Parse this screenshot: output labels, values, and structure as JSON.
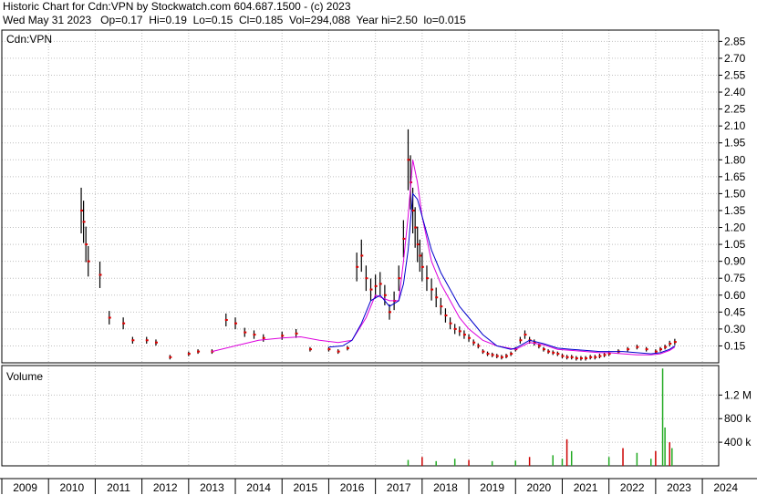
{
  "header": {
    "line1": "Historic Chart for Cdn:VPN by Stockwatch.com 604.687.1500 - (c) 2023",
    "line2": "Wed May 31 2023   Op=0.17  Hi=0.19  Lo=0.15  Cl=0.185  Vol=294,088  Year hi=2.50  lo=0.015"
  },
  "price_panel": {
    "label": "Cdn:VPN"
  },
  "volume_panel": {
    "label": "Volume"
  },
  "colors": {
    "price_bars": "#000000",
    "close_marks": "#dd0000",
    "ma_short": "#0000cc",
    "ma_long": "#dd00dd",
    "volume_up": "#22aa22",
    "volume_down": "#cc0000",
    "grid": "#c0c0c0"
  },
  "chart_data": {
    "type": "line",
    "title": "Historic Chart for Cdn:VPN",
    "ylabel": "",
    "xlabel": "",
    "grid": true,
    "price_axis": {
      "ticks": [
        0.15,
        0.3,
        0.45,
        0.6,
        0.75,
        0.9,
        1.05,
        1.2,
        1.35,
        1.5,
        1.65,
        1.8,
        1.95,
        2.1,
        2.25,
        2.4,
        2.55,
        2.7,
        2.85
      ],
      "tick_labels": [
        "0.15",
        "0.30",
        "0.45",
        "0.60",
        "0.75",
        "0.90",
        "1.05",
        "1.20",
        "1.35",
        "1.50",
        "1.65",
        "1.80",
        "1.95",
        "2.10",
        "2.25",
        "2.40",
        "2.55",
        "2.70",
        "2.85"
      ],
      "ylim": [
        0,
        2.95
      ],
      "position": "right"
    },
    "volume_axis": {
      "ticks": [
        400000,
        800000,
        1200000
      ],
      "tick_labels": [
        "400 k",
        "800 k",
        "1.2 M"
      ],
      "ylim": [
        0,
        1700000
      ],
      "position": "right"
    },
    "x_axis": {
      "years": [
        "2009",
        "2010",
        "2011",
        "2012",
        "2013",
        "2014",
        "2015",
        "2016",
        "2017",
        "2018",
        "2019",
        "2020",
        "2021",
        "2022",
        "2023",
        "2024"
      ],
      "xlim": [
        2009.0,
        2024.35
      ]
    },
    "series": [
      {
        "role": "close",
        "x": [
          2010.7,
          2010.75,
          2010.8,
          2010.85,
          2011.1,
          2011.3,
          2011.6,
          2011.8,
          2012.1,
          2012.3,
          2012.6,
          2013.0,
          2013.2,
          2013.5,
          2013.8,
          2014.0,
          2014.2,
          2014.4,
          2014.6,
          2015.0,
          2015.3,
          2015.6,
          2016.0,
          2016.2,
          2016.4,
          2016.6,
          2016.7,
          2016.8,
          2016.9,
          2017.0,
          2017.1,
          2017.2,
          2017.3,
          2017.4,
          2017.5,
          2017.6,
          2017.7,
          2017.75,
          2017.8,
          2017.85,
          2017.9,
          2017.95,
          2018.0,
          2018.1,
          2018.2,
          2018.3,
          2018.4,
          2018.5,
          2018.6,
          2018.7,
          2018.8,
          2018.9,
          2019.0,
          2019.1,
          2019.2,
          2019.3,
          2019.4,
          2019.5,
          2019.6,
          2019.7,
          2019.8,
          2019.9,
          2020.0,
          2020.1,
          2020.2,
          2020.3,
          2020.4,
          2020.5,
          2020.6,
          2020.7,
          2020.8,
          2020.9,
          2021.0,
          2021.1,
          2021.2,
          2021.3,
          2021.4,
          2021.5,
          2021.6,
          2021.7,
          2021.8,
          2021.9,
          2022.0,
          2022.2,
          2022.4,
          2022.6,
          2022.8,
          2023.0,
          2023.1,
          2023.2,
          2023.3,
          2023.41
        ],
        "values": [
          1.35,
          1.25,
          1.05,
          0.9,
          0.78,
          0.4,
          0.35,
          0.2,
          0.2,
          0.18,
          0.05,
          0.08,
          0.1,
          0.1,
          0.38,
          0.35,
          0.27,
          0.25,
          0.22,
          0.24,
          0.26,
          0.12,
          0.12,
          0.1,
          0.13,
          0.85,
          0.95,
          0.75,
          0.65,
          0.68,
          0.7,
          0.6,
          0.45,
          0.55,
          0.75,
          1.1,
          1.8,
          1.6,
          1.35,
          1.2,
          1.05,
          0.95,
          0.85,
          0.75,
          0.65,
          0.58,
          0.5,
          0.42,
          0.35,
          0.3,
          0.28,
          0.25,
          0.22,
          0.18,
          0.15,
          0.1,
          0.08,
          0.07,
          0.06,
          0.05,
          0.06,
          0.08,
          0.12,
          0.2,
          0.25,
          0.2,
          0.18,
          0.15,
          0.12,
          0.1,
          0.09,
          0.08,
          0.06,
          0.05,
          0.05,
          0.04,
          0.04,
          0.04,
          0.05,
          0.05,
          0.06,
          0.07,
          0.08,
          0.1,
          0.12,
          0.14,
          0.12,
          0.1,
          0.12,
          0.14,
          0.17,
          0.185
        ]
      },
      {
        "role": "moving-average-short",
        "x": [
          2016.0,
          2016.3,
          2016.5,
          2016.7,
          2016.9,
          2017.1,
          2017.3,
          2017.5,
          2017.6,
          2017.7,
          2017.8,
          2017.9,
          2018.0,
          2018.2,
          2018.4,
          2018.6,
          2018.8,
          2019.0,
          2019.3,
          2019.6,
          2019.9,
          2020.0,
          2020.3,
          2020.6,
          2020.9,
          2021.2,
          2021.5,
          2021.8,
          2022.0,
          2022.3,
          2022.6,
          2022.9,
          2023.1,
          2023.3,
          2023.41
        ],
        "values": [
          0.14,
          0.15,
          0.2,
          0.35,
          0.55,
          0.6,
          0.5,
          0.55,
          0.7,
          1.0,
          1.5,
          1.45,
          1.3,
          1.0,
          0.8,
          0.65,
          0.5,
          0.4,
          0.25,
          0.15,
          0.12,
          0.13,
          0.2,
          0.17,
          0.13,
          0.12,
          0.11,
          0.1,
          0.1,
          0.1,
          0.09,
          0.08,
          0.09,
          0.12,
          0.15
        ]
      },
      {
        "role": "moving-average-long",
        "x": [
          2013.5,
          2014.0,
          2014.5,
          2015.0,
          2015.4,
          2015.8,
          2016.2,
          2016.5,
          2016.8,
          2017.0,
          2017.3,
          2017.5,
          2017.6,
          2017.7,
          2017.8,
          2017.9,
          2018.0,
          2018.2,
          2018.4,
          2018.6,
          2018.8,
          2019.0,
          2019.3,
          2019.6,
          2020.0,
          2020.3,
          2020.6,
          2020.9,
          2021.2,
          2021.5,
          2021.8,
          2022.0,
          2022.3,
          2022.6,
          2022.9,
          2023.1,
          2023.3,
          2023.41
        ],
        "values": [
          0.1,
          0.15,
          0.2,
          0.22,
          0.23,
          0.2,
          0.18,
          0.2,
          0.4,
          0.6,
          0.55,
          0.55,
          0.9,
          1.3,
          1.8,
          1.6,
          1.3,
          0.9,
          0.7,
          0.55,
          0.4,
          0.3,
          0.2,
          0.15,
          0.12,
          0.18,
          0.16,
          0.12,
          0.11,
          0.1,
          0.09,
          0.09,
          0.08,
          0.07,
          0.07,
          0.08,
          0.11,
          0.14
        ]
      },
      {
        "role": "volume",
        "x": [
          2017.7,
          2018.0,
          2018.3,
          2018.7,
          2019.0,
          2019.5,
          2020.0,
          2020.3,
          2020.8,
          2021.0,
          2021.1,
          2021.2,
          2022.0,
          2022.3,
          2022.6,
          2022.9,
          2023.0,
          2023.15,
          2023.2,
          2023.3,
          2023.35
        ],
        "values": [
          100000,
          150000,
          80000,
          120000,
          100000,
          80000,
          90000,
          150000,
          180000,
          120000,
          450000,
          250000,
          150000,
          300000,
          220000,
          120000,
          250000,
          1650000,
          650000,
          400000,
          300000
        ]
      }
    ]
  }
}
